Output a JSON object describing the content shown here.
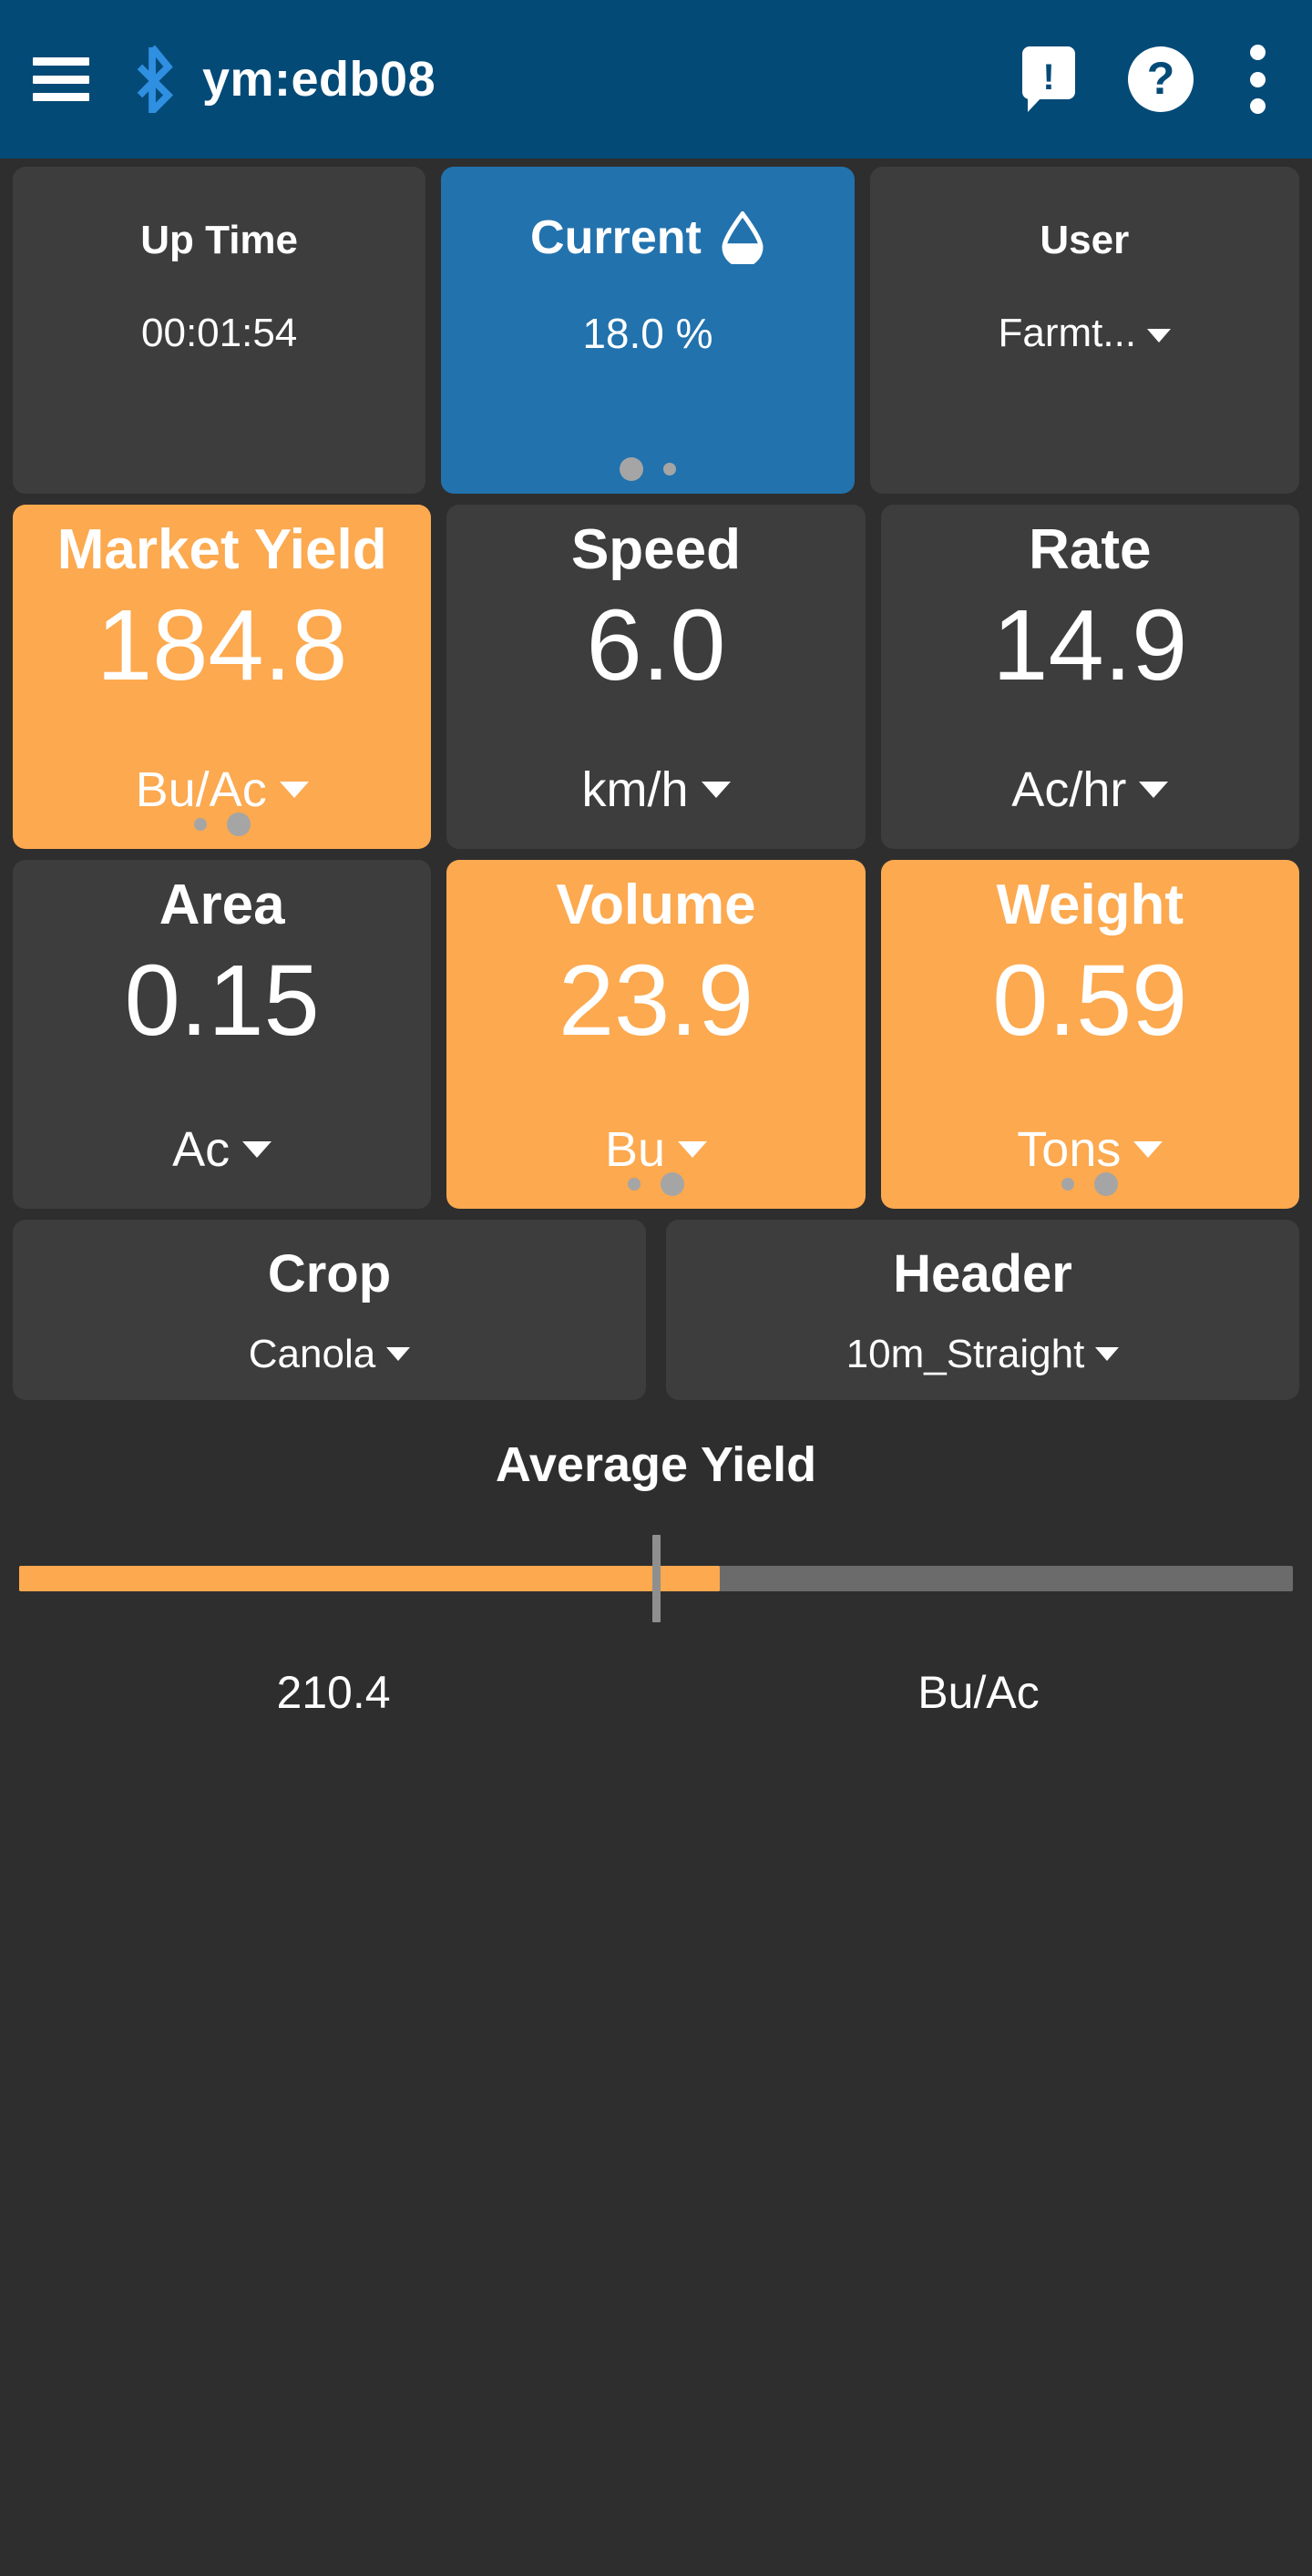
{
  "appbar": {
    "title": "ym:edb08",
    "menu_icon": "hamburger-menu-icon",
    "bluetooth_icon": "bluetooth-icon",
    "alert_icon": "alert-message-icon",
    "alert_glyph": "!",
    "help_icon": "help-icon",
    "help_glyph": "?",
    "overflow_icon": "overflow-menu-icon"
  },
  "status_row": [
    {
      "label": "Up Time",
      "value": "00:01:54",
      "style": "dark",
      "has_caret": false,
      "dots": null,
      "icon": null
    },
    {
      "label": "Current",
      "value": "18.0 %",
      "style": "primary",
      "has_caret": false,
      "dots": {
        "count": 2,
        "active": 0
      },
      "icon": "water-drop-icon"
    },
    {
      "label": "User",
      "value": "Farmt...",
      "style": "dark",
      "has_caret": true,
      "dots": null,
      "icon": null
    }
  ],
  "metrics": [
    {
      "label": "Market Yield",
      "value": "184.8",
      "unit": "Bu/Ac",
      "style": "accent",
      "dots": {
        "count": 2,
        "active": 1
      }
    },
    {
      "label": "Speed",
      "value": "6.0",
      "unit": "km/h",
      "style": "dark",
      "dots": null
    },
    {
      "label": "Rate",
      "value": "14.9",
      "unit": "Ac/hr",
      "style": "dark",
      "dots": null
    },
    {
      "label": "Area",
      "value": "0.15",
      "unit": "Ac",
      "style": "dark",
      "dots": null
    },
    {
      "label": "Volume",
      "value": "23.9",
      "unit": "Bu",
      "style": "accent",
      "dots": {
        "count": 2,
        "active": 1
      }
    },
    {
      "label": "Weight",
      "value": "0.59",
      "unit": "Tons",
      "style": "accent",
      "dots": {
        "count": 2,
        "active": 1
      }
    }
  ],
  "selectors": [
    {
      "label": "Crop",
      "value": "Canola"
    },
    {
      "label": "Header",
      "value": "10m_Straight"
    }
  ],
  "gauge": {
    "title": "Average Yield",
    "value": "210.4",
    "unit": "Bu/Ac",
    "fill_percent": 55,
    "tick_percent": 50
  },
  "colors": {
    "appbar": "#044a77",
    "background": "#2e2e2e",
    "card": "#3d3d3d",
    "accent": "#fca94f",
    "primary": "#2272ad",
    "text": "#ffffff",
    "track": "#6b6b6b",
    "dot": "#a5a5a5"
  }
}
